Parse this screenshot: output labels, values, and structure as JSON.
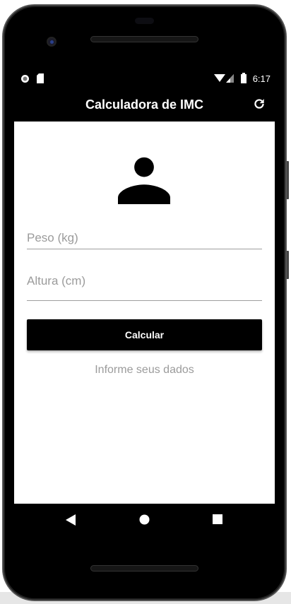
{
  "status_bar": {
    "time": "6:17",
    "icons": [
      "record-icon",
      "sd-card-icon",
      "wifi-icon",
      "signal-icon",
      "battery-icon"
    ]
  },
  "app_bar": {
    "title": "Calculadora de IMC",
    "action_icon": "refresh-icon"
  },
  "form": {
    "avatar_icon": "person-icon",
    "weight_placeholder": "Peso (kg)",
    "height_placeholder": "Altura (cm)",
    "calculate_label": "Calcular",
    "info_text": "Informe seus dados"
  },
  "nav_bar": {
    "icons": [
      "back-icon",
      "home-icon",
      "recents-icon"
    ]
  },
  "colors": {
    "primary": "#000000",
    "hint": "#9b9b9b",
    "background": "#ffffff"
  }
}
